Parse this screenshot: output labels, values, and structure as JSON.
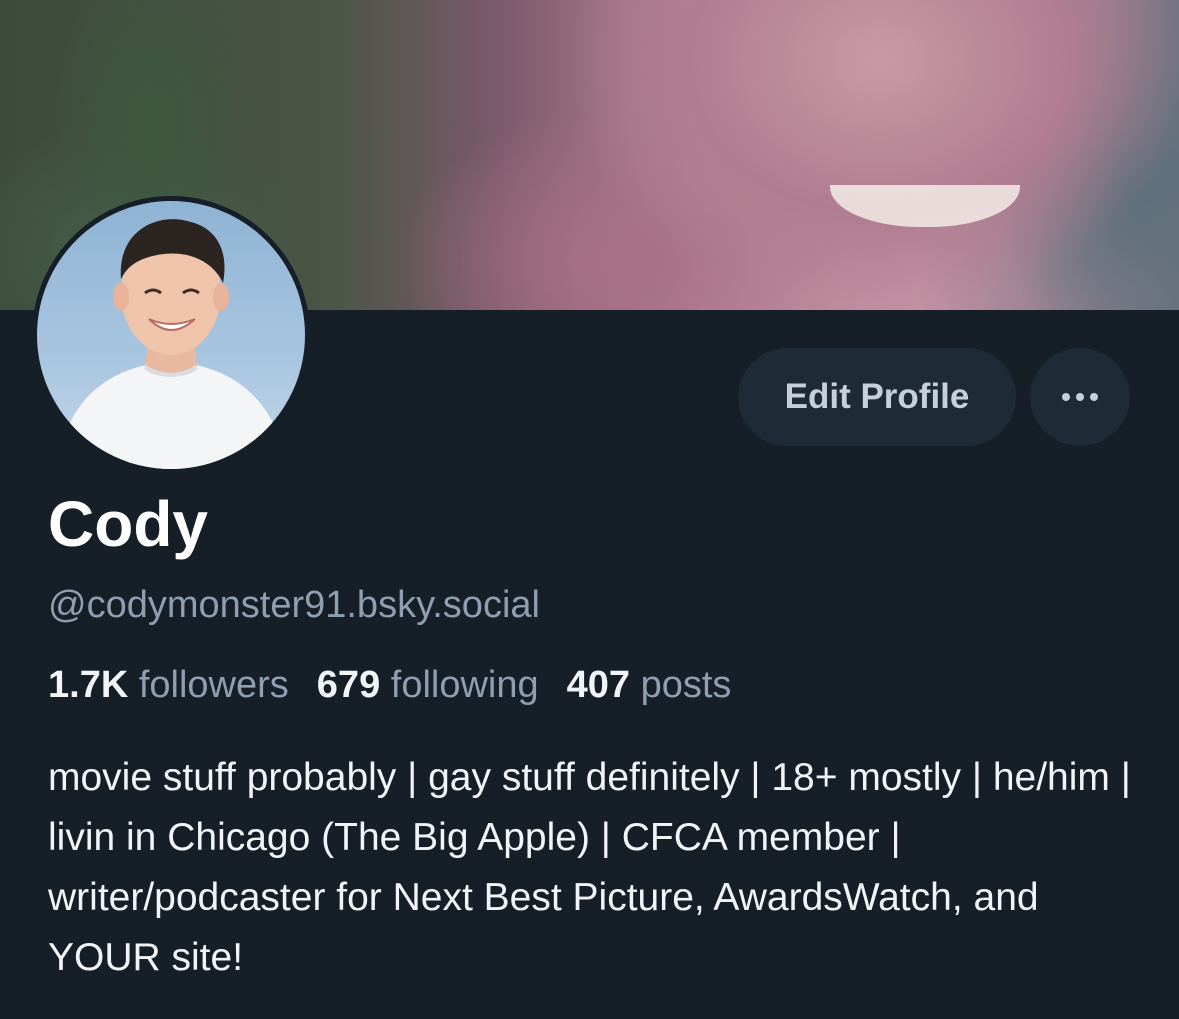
{
  "profile": {
    "display_name": "Cody",
    "handle": "@codymonster91.bsky.social",
    "stats": {
      "followers_count": "1.7K",
      "followers_label": "followers",
      "following_count": "679",
      "following_label": "following",
      "posts_count": "407",
      "posts_label": "posts"
    },
    "bio": "movie stuff probably | gay stuff definitely | 18+ mostly | he/him | livin in Chicago (The Big Apple) | CFCA member | writer/podcaster for Next Best Picture, AwardsWatch, and YOUR site!"
  },
  "actions": {
    "edit_profile_label": "Edit Profile",
    "more_icon": "ellipsis-icon"
  },
  "colors": {
    "background": "#161e27",
    "button_bg": "#1e2a36",
    "muted_text": "#8f9fb1",
    "primary_text": "#ffffff"
  }
}
